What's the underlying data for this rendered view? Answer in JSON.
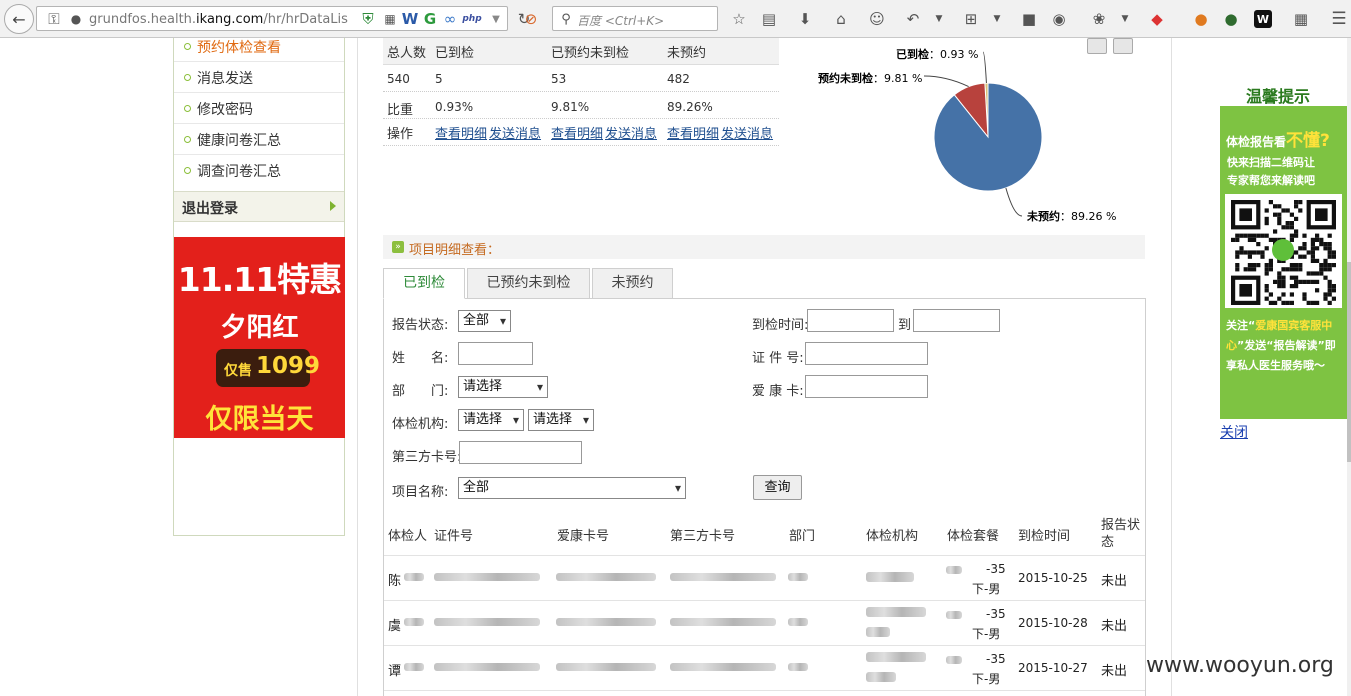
{
  "browser": {
    "url_prefix": "grundfos.health.",
    "url_host": "ikang.com",
    "url_path": "/hr/hrDataLis",
    "search_placeholder": "百度 <Ctrl+K>"
  },
  "sidebar": {
    "items": [
      {
        "label": "预约体检查看",
        "active": true
      },
      {
        "label": "消息发送"
      },
      {
        "label": "修改密码"
      },
      {
        "label": "健康问卷汇总"
      },
      {
        "label": "调查问卷汇总"
      }
    ],
    "logout_label": "退出登录"
  },
  "promo": {
    "line1": "11.11特惠",
    "line2": "夕阳红",
    "price_prefix": "仅售",
    "price": "1099",
    "line4": "仅限当天"
  },
  "summary": {
    "headers": [
      "总人数",
      "已到检",
      "已预约未到检",
      "未预约"
    ],
    "counts": [
      "540",
      "5",
      "53",
      "482"
    ],
    "ratio_label": "比重",
    "ratios": [
      "0.93%",
      "9.81%",
      "89.26%"
    ],
    "action_label": "操作",
    "view_detail": "查看明细",
    "send_message": "发送消息"
  },
  "chart_data": {
    "type": "pie",
    "slices": [
      {
        "label": "已到检",
        "value": 0.93,
        "color": "#d9c27a"
      },
      {
        "label": "预约未到检",
        "value": 9.81,
        "color": "#b8423d"
      },
      {
        "label": "未预约",
        "value": 89.26,
        "color": "#4572a7"
      }
    ],
    "label_texts": [
      "已到检",
      "：0.93 %",
      "预约未到检",
      "：9.81 %",
      "未预约",
      "：89.26 %"
    ]
  },
  "section_title": "项目明细查看：",
  "tabs": [
    {
      "label": "已到检",
      "active": true
    },
    {
      "label": "已预约未到检"
    },
    {
      "label": "未预约"
    }
  ],
  "form": {
    "report_status_label": "报告状态:",
    "report_status_value": "全部",
    "name_label": "姓　　名:",
    "dept_label": "部　　门:",
    "dept_value": "请选择",
    "org_label": "体检机构:",
    "org_value1": "请选择",
    "org_value2": "请选择",
    "third_card_label": "第三方卡号:",
    "project_label": "项目名称:",
    "project_value": "全部",
    "arrive_time_label": "到检时间:",
    "to_label": "到",
    "id_label": "证 件 号:",
    "card_label": "爱 康 卡:",
    "query_button": "查询"
  },
  "table": {
    "headers": [
      "体检人",
      "证件号",
      "爱康卡号",
      "第三方卡号",
      "部门",
      "体检机构",
      "体检套餐",
      "到检时间",
      "报告状态"
    ],
    "rows": [
      {
        "name": "陈",
        "pkg1": "-35",
        "pkg2": "下-男",
        "date": "2015-10-25",
        "status": "未出"
      },
      {
        "name": "虞",
        "pkg1": "-35",
        "pkg2": "下-男",
        "date": "2015-10-28",
        "status": "未出"
      },
      {
        "name": "谭",
        "pkg1": "-35",
        "pkg2": "下-男",
        "date": "2015-10-27",
        "status": "未出"
      }
    ]
  },
  "right_ad": {
    "tips_title": "温馨提示",
    "line1_prefix": "体检报告看",
    "line1_emph": "不懂?",
    "line2a": "快来扫描二维码让",
    "line2b": "专家帮您来解读吧",
    "line3_prefix": "关注“",
    "line3_emph": "爱康国宾客服中心",
    "line3_rest": "”发送“报告解读”即享私人医生服务哦～",
    "close_label": "关闭"
  },
  "watermark": "www.wooyun.org"
}
